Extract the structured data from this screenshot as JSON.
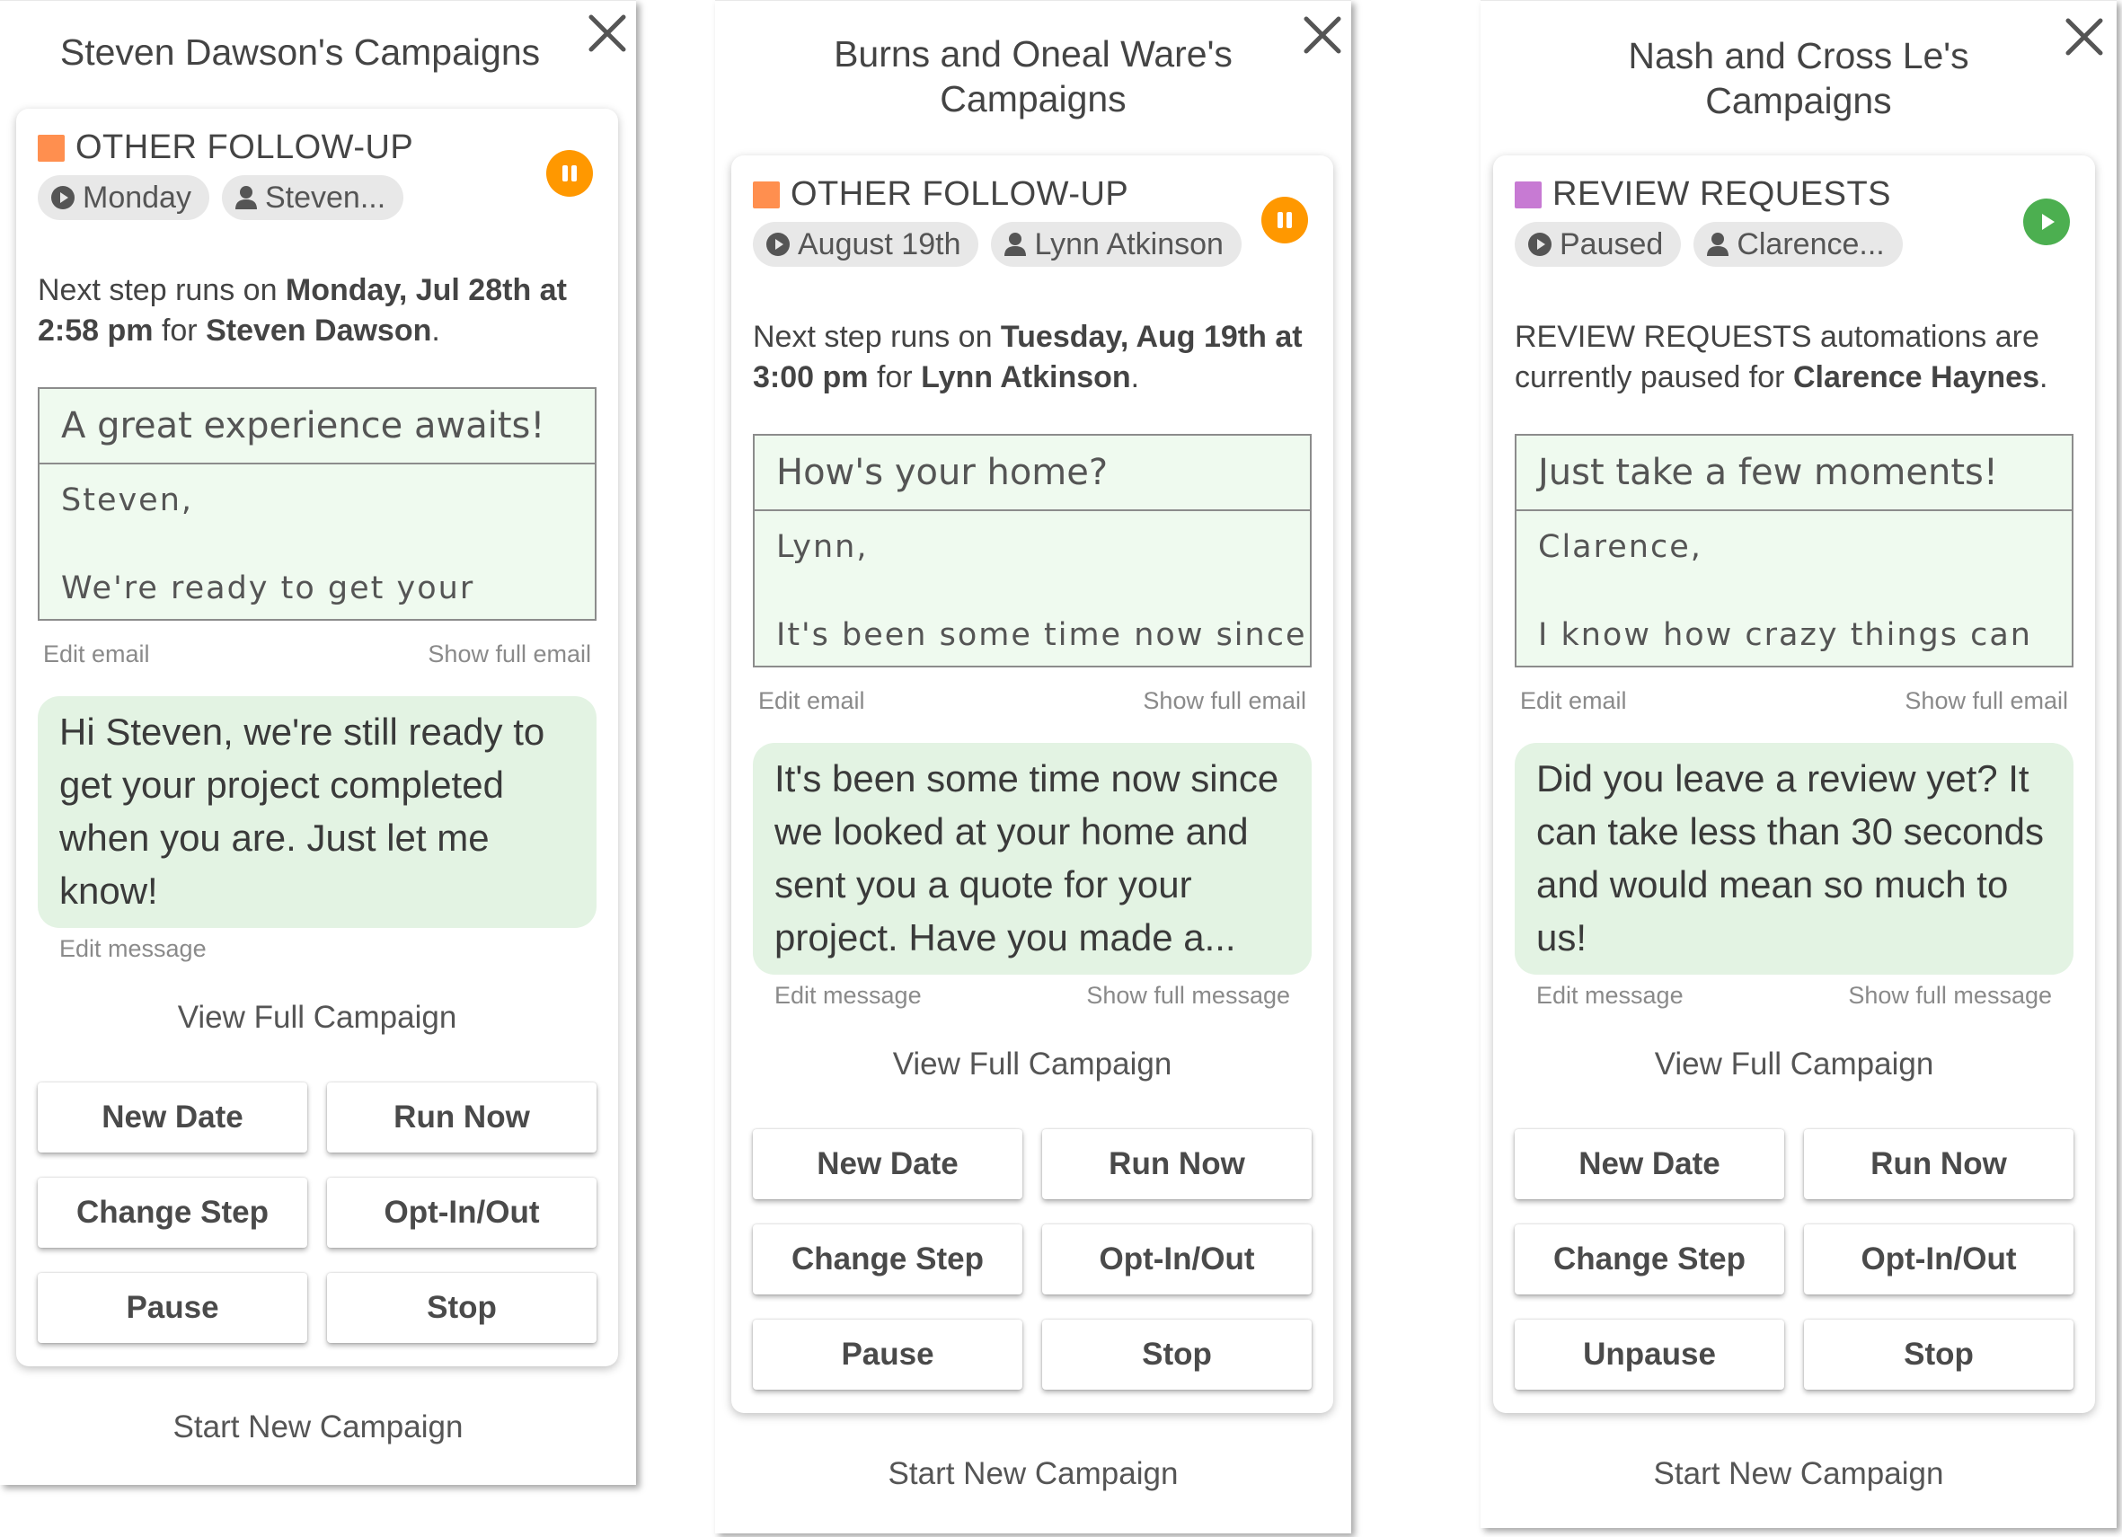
{
  "colors": {
    "followup_orange": "#ff8f4f",
    "review_purple": "#c77ad3",
    "pause_orange": "#ff9800",
    "play_green": "#4caf50",
    "email_bg": "#effaef",
    "message_bg": "#e3f3e3"
  },
  "panels": [
    {
      "title": "Steven Dawson's Campaigns",
      "close_icon": "close-icon",
      "card": {
        "type_label": "OTHER FOLLOW-UP",
        "chip_date": "Monday",
        "chip_person": "Steven...",
        "status_icon": "pause-icon",
        "next_prefix": "Next step runs on ",
        "next_when": "Monday, Jul 28th at 2:58 pm",
        "next_mid": " for ",
        "next_who": "Steven Dawson",
        "next_end": ".",
        "email_subject": "A great experience awaits!",
        "email_greeting": "Steven,",
        "email_preview": "We're ready to get your",
        "edit_email": "Edit email",
        "show_full_email": "Show full email",
        "message": "Hi Steven, we're still ready to get your project completed when you are. Just let me know!",
        "edit_message": "Edit message",
        "show_full_message": "",
        "view_full": "View Full Campaign",
        "buttons": [
          "New Date",
          "Run Now",
          "Change Step",
          "Opt-In/Out",
          "Pause",
          "Stop"
        ]
      },
      "start_new": "Start New Campaign"
    },
    {
      "title": "Burns and Oneal Ware's Campaigns",
      "close_icon": "close-icon",
      "card": {
        "type_label": "OTHER FOLLOW-UP",
        "chip_date": "August 19th",
        "chip_person": "Lynn Atkinson",
        "status_icon": "pause-icon",
        "next_prefix": "Next step runs on ",
        "next_when": "Tuesday, Aug 19th at 3:00 pm",
        "next_mid": " for ",
        "next_who": "Lynn Atkinson",
        "next_end": ".",
        "email_subject": "How's your home?",
        "email_greeting": "Lynn,",
        "email_preview": "It's been some time now since",
        "edit_email": "Edit email",
        "show_full_email": "Show full email",
        "message": "It's been some time now since we looked at your home and sent you a quote for your project. Have you made a...",
        "edit_message": "Edit message",
        "show_full_message": "Show full message",
        "view_full": "View Full Campaign",
        "buttons": [
          "New Date",
          "Run Now",
          "Change Step",
          "Opt-In/Out",
          "Pause",
          "Stop"
        ]
      },
      "start_new": "Start New Campaign"
    },
    {
      "title": "Nash and Cross Le's Campaigns",
      "close_icon": "close-icon",
      "card": {
        "type_label": "REVIEW REQUESTS",
        "chip_date": "Paused",
        "chip_person": "Clarence...",
        "status_icon": "play-icon",
        "next_prefix": "REVIEW REQUESTS automations are currently paused for ",
        "next_when": "",
        "next_mid": "",
        "next_who": "Clarence Haynes",
        "next_end": ".",
        "email_subject": "Just take a few moments!",
        "email_greeting": "Clarence,",
        "email_preview": "I know how crazy things can",
        "edit_email": "Edit email",
        "show_full_email": "Show full email",
        "message": "Did you leave a review yet? It can take less than 30 seconds and would mean so much to us!",
        "edit_message": "Edit message",
        "show_full_message": "Show full message",
        "view_full": "View Full Campaign",
        "buttons": [
          "New Date",
          "Run Now",
          "Change Step",
          "Opt-In/Out",
          "Unpause",
          "Stop"
        ]
      },
      "start_new": "Start New Campaign"
    }
  ]
}
